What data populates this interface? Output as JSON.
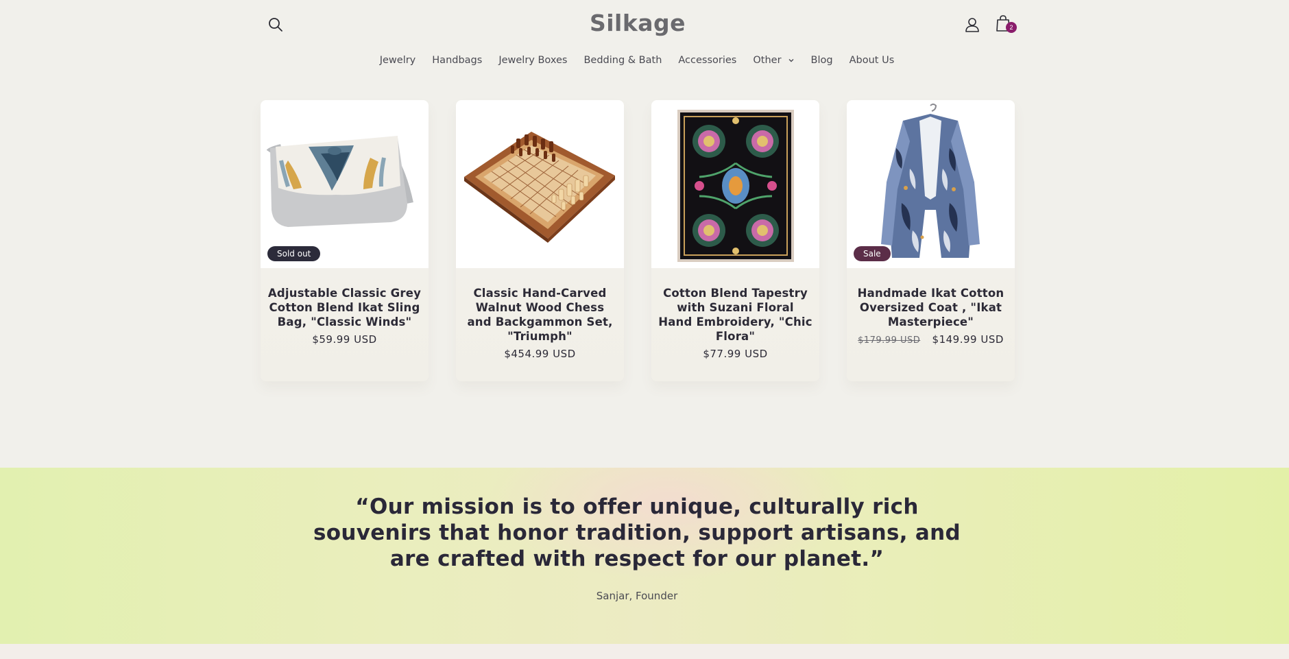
{
  "header": {
    "logo": "Silkage",
    "cart_count": "2",
    "icons": {
      "search": "search-icon",
      "account": "user-icon",
      "cart": "shopping-bag-icon"
    }
  },
  "nav": {
    "items": [
      {
        "label": "Jewelry"
      },
      {
        "label": "Handbags"
      },
      {
        "label": "Jewelry Boxes"
      },
      {
        "label": "Bedding & Bath"
      },
      {
        "label": "Accessories"
      },
      {
        "label": "Other",
        "has_dropdown": true
      },
      {
        "label": "Blog"
      },
      {
        "label": "About Us"
      }
    ]
  },
  "products": [
    {
      "title": "Adjustable Classic Grey Cotton Blend Ikat Sling Bag, \"Classic Winds\"",
      "price": "$59.99 USD",
      "badge": "Sold out"
    },
    {
      "title": "Classic Hand-Carved Walnut Wood Chess and Backgammon Set, \"Triumph\"",
      "price": "$454.99 USD"
    },
    {
      "title": "Cotton Blend Tapestry with Suzani Floral Hand Embroidery, \"Chic Flora\"",
      "price": "$77.99 USD"
    },
    {
      "title": "Handmade Ikat Cotton Oversized Coat , \"Ikat Masterpiece\"",
      "old_price": "$179.99 USD",
      "price": "$149.99 USD",
      "badge": "Sale"
    }
  ],
  "mission": {
    "quote_lines": [
      "“Our mission is to offer unique, culturally rich",
      "souvenirs that honor tradition, support artisans, and",
      "are crafted with respect for our planet.”"
    ],
    "author": "Sanjar, Founder"
  },
  "colors": {
    "background": "#f1f0eb",
    "cart_badge": "#8a1d6b",
    "sold_out_badge": "#2c2b3a",
    "sale_badge": "#5b2d48",
    "mission_band": "#e6efb5"
  }
}
